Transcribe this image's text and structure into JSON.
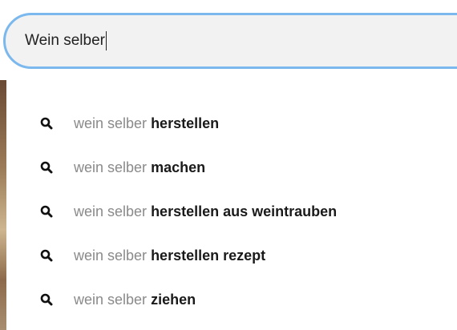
{
  "search": {
    "value": "Wein selber"
  },
  "suggestions": [
    {
      "prefix": "wein selber",
      "completion": "herstellen",
      "icon": "search-icon"
    },
    {
      "prefix": "wein selber",
      "completion": "machen",
      "icon": "search-icon"
    },
    {
      "prefix": "wein selber",
      "completion": "herstellen aus weintrauben",
      "icon": "search-icon"
    },
    {
      "prefix": "wein selber",
      "completion": "herstellen rezept",
      "icon": "search-icon"
    },
    {
      "prefix": "wein selber",
      "completion": "ziehen",
      "icon": "search-icon"
    }
  ],
  "colors": {
    "focus_ring": "#7ab8ee",
    "input_background": "#f2f2f2",
    "prefix_text": "#8a8a8a",
    "completion_text": "#1a1a1a"
  }
}
